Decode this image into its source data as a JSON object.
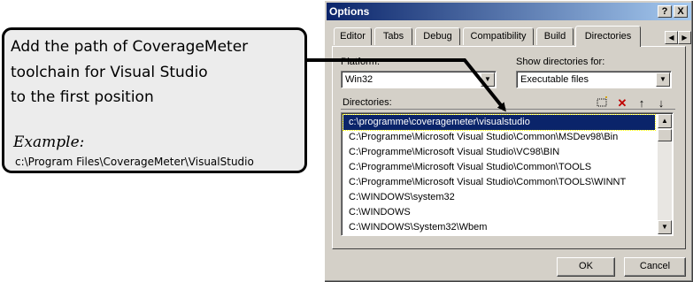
{
  "callout": {
    "line1": "Add the path of CoverageMeter",
    "line2": "toolchain for Visual Studio",
    "line3": "to the first position",
    "example_heading": "Example:",
    "example_path": "c:\\Program Files\\CoverageMeter\\VisualStudio"
  },
  "dialog": {
    "title": "Options",
    "help_label": "?",
    "close_label": "X",
    "tabs": [
      "Editor",
      "Tabs",
      "Debug",
      "Compatibility",
      "Build",
      "Directories"
    ],
    "active_tab": "Directories",
    "platform_label": "Platform:",
    "platform_value": "Win32",
    "show_dirs_label": "Show directories for:",
    "show_dirs_value": "Executable files",
    "directories_label": "Directories:",
    "directories": [
      "c:\\programme\\coveragemeter\\visualstudio",
      "C:\\Programme\\Microsoft Visual Studio\\Common\\MSDev98\\Bin",
      "C:\\Programme\\Microsoft Visual Studio\\VC98\\BIN",
      "C:\\Programme\\Microsoft Visual Studio\\Common\\TOOLS",
      "C:\\Programme\\Microsoft Visual Studio\\Common\\TOOLS\\WINNT",
      "C:\\WINDOWS\\system32",
      "C:\\WINDOWS",
      "C:\\WINDOWS\\System32\\Wbem"
    ],
    "selected_index": 0,
    "ok_label": "OK",
    "cancel_label": "Cancel"
  },
  "colors": {
    "title_bar": "#0a246a",
    "dialog_face": "#d4d0c8",
    "selection": "#0a246a",
    "callout_fill": "#ececec"
  },
  "icons": [
    "new-folder-icon",
    "delete-icon",
    "move-up-icon",
    "move-down-icon"
  ]
}
